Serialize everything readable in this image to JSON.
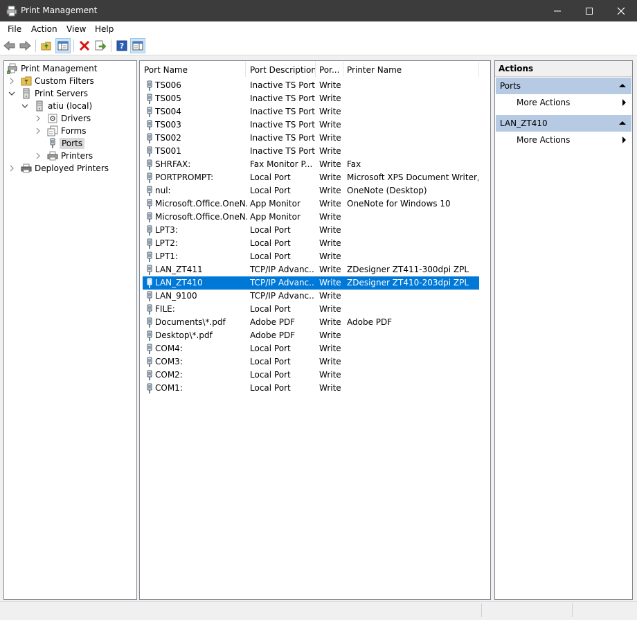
{
  "window": {
    "title": "Print Management"
  },
  "menu": [
    "File",
    "Action",
    "View",
    "Help"
  ],
  "toolbar": {
    "buttons": [
      "back-icon",
      "forward-icon",
      "up-folder-icon",
      "show-hide-tree-icon",
      "delete-icon",
      "export-icon",
      "help-icon",
      "show-action-pane-icon"
    ]
  },
  "tree": {
    "root": "Print Management",
    "custom_filters": "Custom Filters",
    "print_servers": "Print Servers",
    "server": "atiu (local)",
    "drivers": "Drivers",
    "forms": "Forms",
    "ports": "Ports",
    "printers": "Printers",
    "deployed_printers": "Deployed Printers"
  },
  "list": {
    "columns": {
      "name": "Port Name",
      "desc": "Port Description",
      "type": "Por...",
      "printer": "Printer Name"
    },
    "rows": [
      {
        "name": "TS006",
        "desc": "Inactive TS Port",
        "type": "Write",
        "printer": ""
      },
      {
        "name": "TS005",
        "desc": "Inactive TS Port",
        "type": "Write",
        "printer": ""
      },
      {
        "name": "TS004",
        "desc": "Inactive TS Port",
        "type": "Write",
        "printer": ""
      },
      {
        "name": "TS003",
        "desc": "Inactive TS Port",
        "type": "Write",
        "printer": ""
      },
      {
        "name": "TS002",
        "desc": "Inactive TS Port",
        "type": "Write",
        "printer": ""
      },
      {
        "name": "TS001",
        "desc": "Inactive TS Port",
        "type": "Write",
        "printer": ""
      },
      {
        "name": "SHRFAX:",
        "desc": "Fax Monitor P...",
        "type": "Write",
        "printer": "Fax"
      },
      {
        "name": "PORTPROMPT:",
        "desc": "Local Port",
        "type": "Write",
        "printer": "Microsoft XPS Document Writer,..."
      },
      {
        "name": "nul:",
        "desc": "Local Port",
        "type": "Write",
        "printer": "OneNote (Desktop)"
      },
      {
        "name": "Microsoft.Office.OneN...",
        "desc": "App Monitor",
        "type": "Write",
        "printer": "OneNote for Windows 10"
      },
      {
        "name": "Microsoft.Office.OneN...",
        "desc": "App Monitor",
        "type": "Write",
        "printer": ""
      },
      {
        "name": "LPT3:",
        "desc": "Local Port",
        "type": "Write",
        "printer": ""
      },
      {
        "name": "LPT2:",
        "desc": "Local Port",
        "type": "Write",
        "printer": ""
      },
      {
        "name": "LPT1:",
        "desc": "Local Port",
        "type": "Write",
        "printer": ""
      },
      {
        "name": "LAN_ZT411",
        "desc": "TCP/IP Advanc...",
        "type": "Write",
        "printer": "ZDesigner ZT411-300dpi ZPL"
      },
      {
        "name": "LAN_ZT410",
        "desc": "TCP/IP Advanc...",
        "type": "Write",
        "printer": "ZDesigner ZT410-203dpi ZPL",
        "selected": true
      },
      {
        "name": "LAN_9100",
        "desc": "TCP/IP Advanc...",
        "type": "Write",
        "printer": ""
      },
      {
        "name": "FILE:",
        "desc": "Local Port",
        "type": "Write",
        "printer": ""
      },
      {
        "name": "Documents\\*.pdf",
        "desc": "Adobe PDF",
        "type": "Write",
        "printer": "Adobe PDF"
      },
      {
        "name": "Desktop\\*.pdf",
        "desc": "Adobe PDF",
        "type": "Write",
        "printer": ""
      },
      {
        "name": "COM4:",
        "desc": "Local Port",
        "type": "Write",
        "printer": ""
      },
      {
        "name": "COM3:",
        "desc": "Local Port",
        "type": "Write",
        "printer": ""
      },
      {
        "name": "COM2:",
        "desc": "Local Port",
        "type": "Write",
        "printer": ""
      },
      {
        "name": "COM1:",
        "desc": "Local Port",
        "type": "Write",
        "printer": ""
      }
    ]
  },
  "actions": {
    "title": "Actions",
    "group1": {
      "title": "Ports",
      "more": "More Actions"
    },
    "group2": {
      "title": "LAN_ZT410",
      "more": "More Actions"
    }
  },
  "colors": {
    "selection": "#0078d7",
    "action_header": "#b6cae3",
    "titlebar": "#3c3c3c"
  }
}
